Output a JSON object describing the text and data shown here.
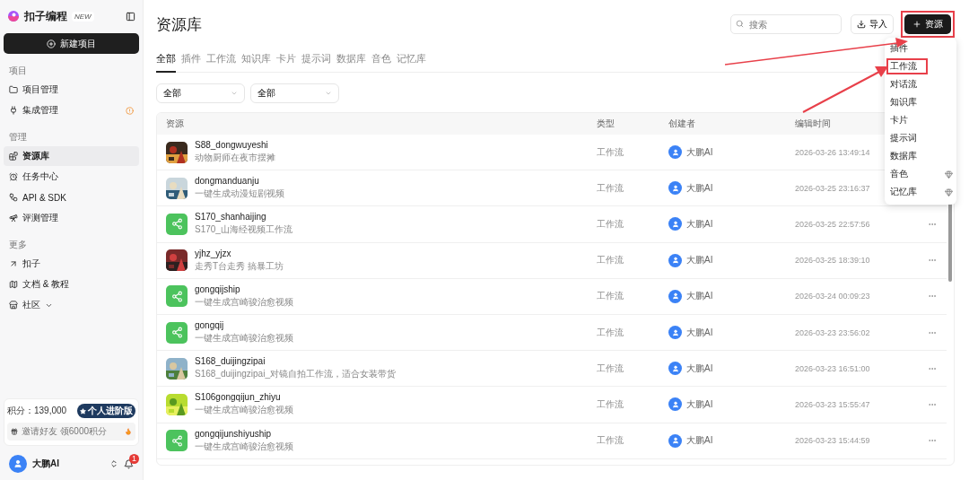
{
  "sidebar": {
    "brand": "扣子编程",
    "badge": "NEW",
    "new_button": "新建项目",
    "sections": [
      {
        "title": "项目",
        "items": [
          {
            "label": "项目管理",
            "selected": false,
            "alert": false
          },
          {
            "label": "集成管理",
            "selected": false,
            "alert": true
          }
        ]
      },
      {
        "title": "管理",
        "items": [
          {
            "label": "资源库",
            "selected": true
          },
          {
            "label": "任务中心",
            "selected": false
          },
          {
            "label": "API & SDK",
            "selected": false
          },
          {
            "label": "评测管理",
            "selected": false
          }
        ]
      },
      {
        "title": "更多",
        "items": [
          {
            "label": "扣子",
            "selected": false,
            "expandable": false
          },
          {
            "label": "文档 & 教程",
            "selected": false,
            "expandable": false
          },
          {
            "label": "社区",
            "selected": false,
            "expandable": true
          }
        ]
      }
    ],
    "points": {
      "label": "积分：139,000",
      "plan": "个人进阶版",
      "invite": "邀请好友 领6000积分"
    },
    "user": {
      "name": "大鹏AI",
      "notifications": "1"
    }
  },
  "page": {
    "title": "资源库",
    "search": {
      "placeholder": "搜索"
    },
    "import_button": "导入",
    "add_button": {
      "label": "资源",
      "highlighted": true
    }
  },
  "tabs": [
    {
      "label": "全部",
      "selected": true
    },
    {
      "label": "插件",
      "selected": false
    },
    {
      "label": "工作流",
      "selected": false
    },
    {
      "label": "知识库",
      "selected": false
    },
    {
      "label": "卡片",
      "selected": false
    },
    {
      "label": "提示词",
      "selected": false
    },
    {
      "label": "数据库",
      "selected": false
    },
    {
      "label": "音色",
      "selected": false
    },
    {
      "label": "记忆库",
      "selected": false
    }
  ],
  "filters": [
    {
      "value": "全部"
    },
    {
      "value": "全部"
    }
  ],
  "table": {
    "columns": [
      "资源",
      "类型",
      "创建者",
      "编辑时间"
    ],
    "rows": [
      {
        "kind": "picture",
        "name": "S88_dongwuyeshi",
        "desc": "动物厨师在夜市摆摊",
        "type": "工作流",
        "creator": "大鹏AI",
        "time": "2026-03-26 13:49:14"
      },
      {
        "kind": "picture",
        "name": "dongmanduanju",
        "desc": "一键生成动漫短剧视频",
        "type": "工作流",
        "creator": "大鹏AI",
        "time": "2026-03-25 23:16:37"
      },
      {
        "kind": "workflow",
        "name": "S170_shanhaijing",
        "desc": "S170_山海经视频工作流",
        "type": "工作流",
        "creator": "大鹏AI",
        "time": "2026-03-25 22:57:56"
      },
      {
        "kind": "picture",
        "name": "yjhz_yjzx",
        "desc": "走秀T台走秀 搞暴工坊",
        "type": "工作流",
        "creator": "大鹏AI",
        "time": "2026-03-25 18:39:10"
      },
      {
        "kind": "workflow",
        "name": "gongqijship",
        "desc": "一键生成宫崎骏治愈视频",
        "type": "工作流",
        "creator": "大鹏AI",
        "time": "2026-03-24 00:09:23"
      },
      {
        "kind": "workflow",
        "name": "gongqij",
        "desc": "一键生成宫崎骏治愈视频",
        "type": "工作流",
        "creator": "大鹏AI",
        "time": "2026-03-23 23:56:02"
      },
      {
        "kind": "picture",
        "name": "S168_duijingzipai",
        "desc": "S168_duijingzipai_对镜自拍工作流，适合女装带货",
        "type": "工作流",
        "creator": "大鹏AI",
        "time": "2026-03-23 16:51:00"
      },
      {
        "kind": "picture",
        "name": "S106gongqijun_zhiyu",
        "desc": "一键生成宫崎骏治愈视频",
        "type": "工作流",
        "creator": "大鹏AI",
        "time": "2026-03-23 15:55:47"
      },
      {
        "kind": "workflow",
        "name": "gongqijunshiyuship",
        "desc": "一键生成宫崎骏治愈视频",
        "type": "工作流",
        "creator": "大鹏AI",
        "time": "2026-03-23 15:44:59"
      }
    ]
  },
  "add_menu": [
    {
      "label": "插件",
      "premium": false,
      "highlighted": false
    },
    {
      "label": "工作流",
      "premium": false,
      "highlighted": true
    },
    {
      "label": "对话流",
      "premium": false,
      "highlighted": false
    },
    {
      "label": "知识库",
      "premium": false,
      "highlighted": false
    },
    {
      "label": "卡片",
      "premium": false,
      "highlighted": false
    },
    {
      "label": "提示词",
      "premium": false,
      "highlighted": false
    },
    {
      "label": "数据库",
      "premium": false,
      "highlighted": false
    },
    {
      "label": "音色",
      "premium": true,
      "highlighted": false
    },
    {
      "label": "记忆库",
      "premium": true,
      "highlighted": false
    }
  ]
}
